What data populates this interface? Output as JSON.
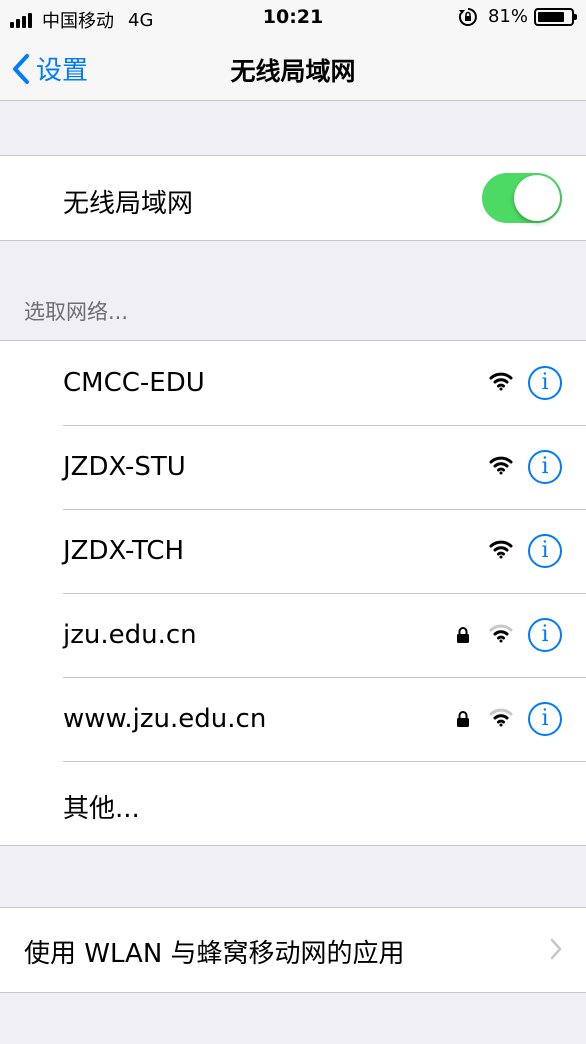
{
  "status_bar": {
    "carrier": "中国移动",
    "network": "4G",
    "time": "10:21",
    "battery_percent": "81%",
    "battery_level": 0.81
  },
  "nav": {
    "back_label": "设置",
    "title": "无线局域网"
  },
  "wifi_toggle": {
    "label": "无线局域网",
    "on": true,
    "color": "#4cd964"
  },
  "networks_section": {
    "header": "选取网络...",
    "networks": [
      {
        "name": "CMCC-EDU",
        "locked": false,
        "info": "i"
      },
      {
        "name": "JZDX-STU",
        "locked": false,
        "info": "i"
      },
      {
        "name": "JZDX-TCH",
        "locked": false,
        "info": "i"
      },
      {
        "name": "jzu.edu.cn",
        "locked": true,
        "info": "i"
      },
      {
        "name": "www.jzu.edu.cn",
        "locked": true,
        "info": "i"
      }
    ],
    "other": "其他..."
  },
  "apps_row": {
    "label": "使用 WLAN 与蜂窝移动网的应用"
  },
  "colors": {
    "accent": "#007aff",
    "background": "#efeff4",
    "separator": "#c8c7cc"
  }
}
